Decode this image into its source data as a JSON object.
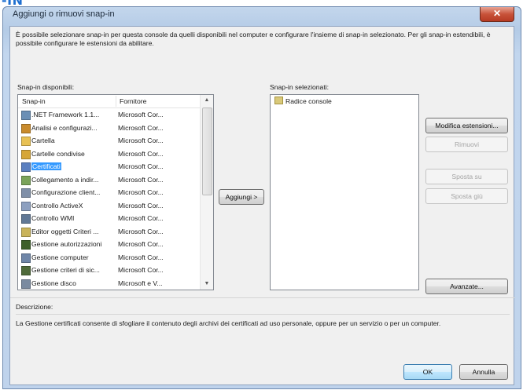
{
  "page_heading_fragment": "-IN",
  "window": {
    "title": "Aggiungi o rimuovi snap-in",
    "close_glyph": "✕"
  },
  "intro_text": "È possibile selezionare snap-in per questa console da quelli disponibili nel computer e configurare l'insieme di snap-in selezionato. Per gli snap-in estendibili, è possibile configurare le estensioni da abilitare.",
  "available": {
    "label": "Snap-in disponibili:",
    "columns": [
      "Snap-in",
      "Fornitore"
    ],
    "scroll_up": "▲",
    "scroll_down": "▼",
    "rows": [
      {
        "name": ".NET Framework 1.1...",
        "vendor": "Microsoft Cor...",
        "icon": "dotnet-icon",
        "color": "#6b8fb5"
      },
      {
        "name": "Analisi e configurazi...",
        "vendor": "Microsoft Cor...",
        "icon": "security-analysis-icon",
        "color": "#c98b2c"
      },
      {
        "name": "Cartella",
        "vendor": "Microsoft Cor...",
        "icon": "folder-icon",
        "color": "#e8c154"
      },
      {
        "name": "Cartelle condivise",
        "vendor": "Microsoft Cor...",
        "icon": "shared-folder-icon",
        "color": "#d6a638"
      },
      {
        "name": "Certificati",
        "vendor": "Microsoft Cor...",
        "icon": "certificate-icon",
        "color": "#5a7fc0",
        "selected": true
      },
      {
        "name": "Collegamento a indir...",
        "vendor": "Microsoft Cor...",
        "icon": "link-icon",
        "color": "#7aa35a"
      },
      {
        "name": "Configurazione client...",
        "vendor": "Microsoft Cor...",
        "icon": "client-config-icon",
        "color": "#7f8fa8"
      },
      {
        "name": "Controllo ActiveX",
        "vendor": "Microsoft Cor...",
        "icon": "activex-icon",
        "color": "#8da0c0"
      },
      {
        "name": "Controllo WMI",
        "vendor": "Microsoft Cor...",
        "icon": "wmi-icon",
        "color": "#607896"
      },
      {
        "name": "Editor oggetti Criteri ...",
        "vendor": "Microsoft Cor...",
        "icon": "policy-editor-icon",
        "color": "#c9b35a"
      },
      {
        "name": "Gestione autorizzazioni",
        "vendor": "Microsoft Cor...",
        "icon": "authorization-icon",
        "color": "#3d5f2a"
      },
      {
        "name": "Gestione computer",
        "vendor": "Microsoft Cor...",
        "icon": "computer-management-icon",
        "color": "#6f86a8"
      },
      {
        "name": "Gestione criteri di sic...",
        "vendor": "Microsoft Cor...",
        "icon": "security-policy-icon",
        "color": "#4f6a3a"
      },
      {
        "name": "Gestione disco",
        "vendor": "Microsoft e V...",
        "icon": "disk-icon",
        "color": "#7a8aa0"
      }
    ]
  },
  "add_button": "Aggiungi >",
  "selected": {
    "label": "Snap-in selezionati:",
    "items": [
      {
        "name": "Radice console",
        "icon": "console-root-icon"
      }
    ]
  },
  "side_buttons": {
    "edit_extensions": "Modifica estensioni...",
    "remove": "Rimuovi",
    "move_up": "Sposta su",
    "move_down": "Sposta giù",
    "advanced": "Avanzate..."
  },
  "description": {
    "label": "Descrizione:",
    "text": "La Gestione certificati consente di sfogliare il contenuto degli archivi dei certificati ad uso personale, oppure per un servizio o per un computer."
  },
  "footer": {
    "ok": "OK",
    "cancel": "Annulla"
  }
}
